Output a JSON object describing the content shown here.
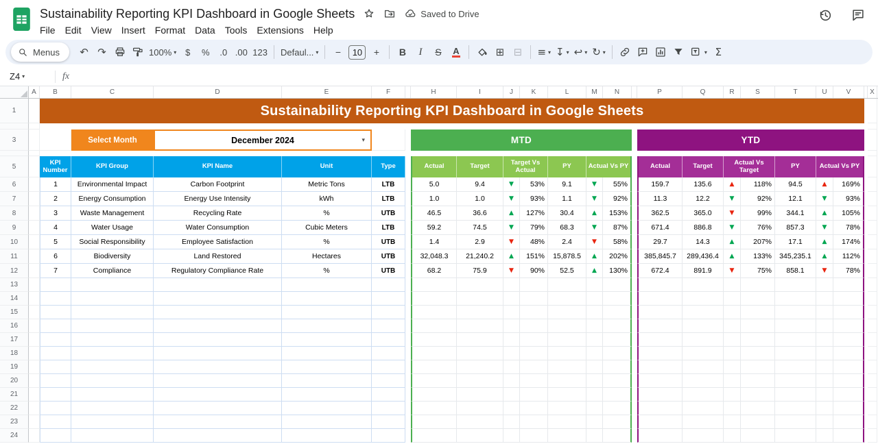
{
  "app": {
    "doc_title": "Sustainability Reporting KPI Dashboard in Google Sheets",
    "saved_status": "Saved to Drive",
    "menus": [
      "File",
      "Edit",
      "View",
      "Insert",
      "Format",
      "Data",
      "Tools",
      "Extensions",
      "Help"
    ]
  },
  "toolbar": {
    "menus_label": "Menus",
    "zoom": "100%",
    "currency": "$",
    "percent": "%",
    "decimal_decrease": ".0",
    "decimal_increase": ".00",
    "more_formats": "123",
    "font_name": "Defaul...",
    "minus": "−",
    "font_size": "10",
    "plus": "+",
    "bold": "B",
    "italic": "I",
    "strikethrough": "S",
    "text_color": "A",
    "functions": "Σ"
  },
  "formula_bar": {
    "cell_ref": "Z4",
    "fx_label": "fx"
  },
  "glyphs": {
    "undo": "↶",
    "redo": "↷",
    "caret": "▾",
    "align": "≡",
    "valign": "↧",
    "wrap": "↩",
    "rotate": "↻",
    "borders": "⊞",
    "merge": "⊟",
    "arrow_up": "▲",
    "arrow_down": "▼"
  },
  "sheet": {
    "column_letters": [
      "A",
      "B",
      "C",
      "D",
      "E",
      "F",
      "",
      "H",
      "I",
      "J",
      "K",
      "L",
      "M",
      "N",
      "",
      "P",
      "Q",
      "R",
      "S",
      "T",
      "U",
      "V",
      "",
      "X"
    ],
    "visible_rows": 24
  },
  "dashboard": {
    "banner_title": "Sustainability Reporting KPI Dashboard in Google Sheets",
    "select_month_label": "Select Month",
    "selected_month": "December 2024",
    "mtd_label": "MTD",
    "ytd_label": "YTD",
    "info_headers": [
      "KPI Number",
      "KPI Group",
      "KPI Name",
      "Unit",
      "Type"
    ],
    "mtd_headers": [
      "Actual",
      "Target",
      "Target Vs Actual",
      "PY",
      "Actual Vs PY"
    ],
    "ytd_headers": [
      "Actual",
      "Target",
      "Actual Vs Target",
      "PY",
      "Actual Vs PY"
    ],
    "colors": {
      "banner": "#c05a11",
      "select_month": "#f0861d",
      "mtd": "#4caf50",
      "mtd_sub": "#8cc751",
      "ytd": "#8e1380",
      "ytd_sub": "#a42e97",
      "info_header": "#00a2e8",
      "arrow_green": "#00a651",
      "arrow_red": "#e8240f"
    },
    "rows": [
      {
        "num": "1",
        "group": "Environmental Impact",
        "name": "Carbon Footprint",
        "unit": "Metric Tons",
        "type": "LTB",
        "mtd_actual": "5.0",
        "mtd_target": "9.4",
        "mtd_tva": {
          "arrow": "down",
          "color": "green",
          "value": "53%"
        },
        "mtd_py": "9.1",
        "mtd_avpy": {
          "arrow": "down",
          "color": "green",
          "value": "55%"
        },
        "ytd_actual": "159.7",
        "ytd_target": "135.6",
        "ytd_avt": {
          "arrow": "up",
          "color": "red",
          "value": "118%"
        },
        "ytd_py": "94.5",
        "ytd_avpy": {
          "arrow": "up",
          "color": "red",
          "value": "169%"
        }
      },
      {
        "num": "2",
        "group": "Energy Consumption",
        "name": "Energy Use Intensity",
        "unit": "kWh",
        "type": "LTB",
        "mtd_actual": "1.0",
        "mtd_target": "1.0",
        "mtd_tva": {
          "arrow": "down",
          "color": "green",
          "value": "93%"
        },
        "mtd_py": "1.1",
        "mtd_avpy": {
          "arrow": "down",
          "color": "green",
          "value": "92%"
        },
        "ytd_actual": "11.3",
        "ytd_target": "12.2",
        "ytd_avt": {
          "arrow": "down",
          "color": "green",
          "value": "92%"
        },
        "ytd_py": "12.1",
        "ytd_avpy": {
          "arrow": "down",
          "color": "green",
          "value": "93%"
        }
      },
      {
        "num": "3",
        "group": "Waste Management",
        "name": "Recycling Rate",
        "unit": "%",
        "type": "UTB",
        "mtd_actual": "46.5",
        "mtd_target": "36.6",
        "mtd_tva": {
          "arrow": "up",
          "color": "green",
          "value": "127%"
        },
        "mtd_py": "30.4",
        "mtd_avpy": {
          "arrow": "up",
          "color": "green",
          "value": "153%"
        },
        "ytd_actual": "362.5",
        "ytd_target": "365.0",
        "ytd_avt": {
          "arrow": "down",
          "color": "red",
          "value": "99%"
        },
        "ytd_py": "344.1",
        "ytd_avpy": {
          "arrow": "up",
          "color": "green",
          "value": "105%"
        }
      },
      {
        "num": "4",
        "group": "Water Usage",
        "name": "Water Consumption",
        "unit": "Cubic Meters",
        "type": "LTB",
        "mtd_actual": "59.2",
        "mtd_target": "74.5",
        "mtd_tva": {
          "arrow": "down",
          "color": "green",
          "value": "79%"
        },
        "mtd_py": "68.3",
        "mtd_avpy": {
          "arrow": "down",
          "color": "green",
          "value": "87%"
        },
        "ytd_actual": "671.4",
        "ytd_target": "886.8",
        "ytd_avt": {
          "arrow": "down",
          "color": "green",
          "value": "76%"
        },
        "ytd_py": "857.3",
        "ytd_avpy": {
          "arrow": "down",
          "color": "green",
          "value": "78%"
        }
      },
      {
        "num": "5",
        "group": "Social Responsibility",
        "name": "Employee Satisfaction",
        "unit": "%",
        "type": "UTB",
        "mtd_actual": "1.4",
        "mtd_target": "2.9",
        "mtd_tva": {
          "arrow": "down",
          "color": "red",
          "value": "48%"
        },
        "mtd_py": "2.4",
        "mtd_avpy": {
          "arrow": "down",
          "color": "red",
          "value": "58%"
        },
        "ytd_actual": "29.7",
        "ytd_target": "14.3",
        "ytd_avt": {
          "arrow": "up",
          "color": "green",
          "value": "207%"
        },
        "ytd_py": "17.1",
        "ytd_avpy": {
          "arrow": "up",
          "color": "green",
          "value": "174%"
        }
      },
      {
        "num": "6",
        "group": "Biodiversity",
        "name": "Land Restored",
        "unit": "Hectares",
        "type": "UTB",
        "mtd_actual": "32,048.3",
        "mtd_target": "21,240.2",
        "mtd_tva": {
          "arrow": "up",
          "color": "green",
          "value": "151%"
        },
        "mtd_py": "15,878.5",
        "mtd_avpy": {
          "arrow": "up",
          "color": "green",
          "value": "202%"
        },
        "ytd_actual": "385,845.7",
        "ytd_target": "289,436.4",
        "ytd_avt": {
          "arrow": "up",
          "color": "green",
          "value": "133%"
        },
        "ytd_py": "345,235.1",
        "ytd_avpy": {
          "arrow": "up",
          "color": "green",
          "value": "112%"
        }
      },
      {
        "num": "7",
        "group": "Compliance",
        "name": "Regulatory Compliance Rate",
        "unit": "%",
        "type": "UTB",
        "mtd_actual": "68.2",
        "mtd_target": "75.9",
        "mtd_tva": {
          "arrow": "down",
          "color": "red",
          "value": "90%"
        },
        "mtd_py": "52.5",
        "mtd_avpy": {
          "arrow": "up",
          "color": "green",
          "value": "130%"
        },
        "ytd_actual": "672.4",
        "ytd_target": "891.9",
        "ytd_avt": {
          "arrow": "down",
          "color": "red",
          "value": "75%"
        },
        "ytd_py": "858.1",
        "ytd_avpy": {
          "arrow": "down",
          "color": "red",
          "value": "78%"
        }
      }
    ]
  }
}
